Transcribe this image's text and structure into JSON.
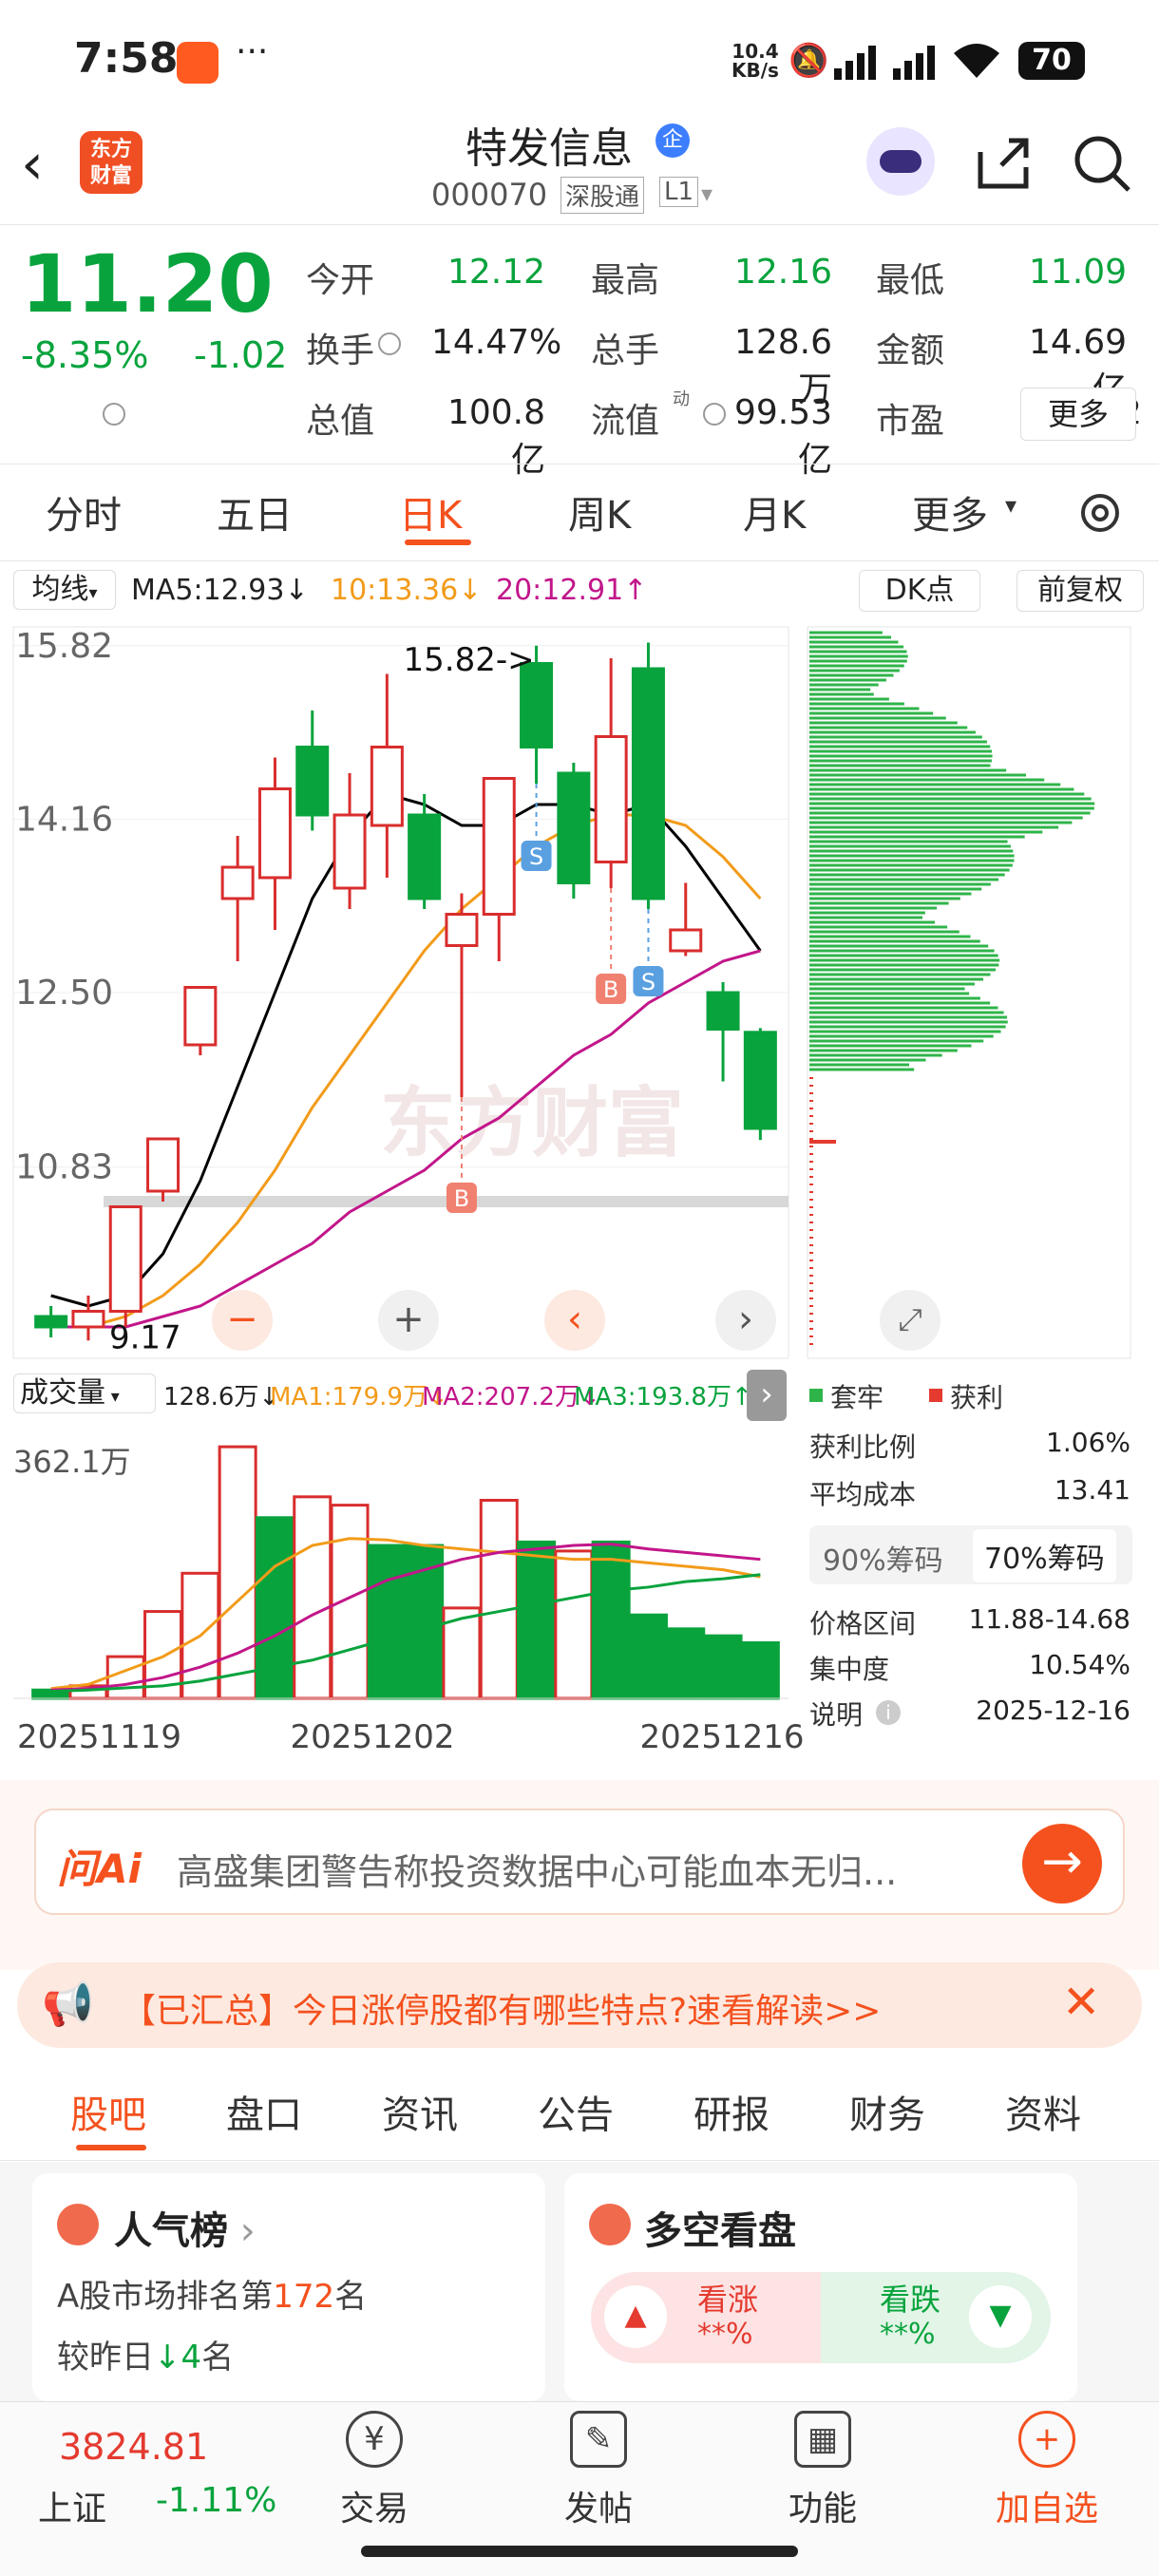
{
  "status": {
    "time": "7:58",
    "net_speed": "10.4",
    "net_unit": "KB/s",
    "battery": "70"
  },
  "header": {
    "logo_line1": "东方",
    "logo_line2": "财富",
    "stock_name": "特发信息",
    "badge": "企",
    "code": "000070",
    "tag1": "深股通",
    "tag2": "L1"
  },
  "quote": {
    "price": "11.20",
    "change_pct": "-8.35%",
    "change": "-1.02",
    "rows": [
      [
        {
          "label": "今开",
          "value": "12.12"
        },
        {
          "label": "最高",
          "value": "12.16"
        },
        {
          "label": "最低",
          "value": "11.09"
        }
      ],
      [
        {
          "label": "换手",
          "value": "14.47%"
        },
        {
          "label": "总手",
          "value": "128.6万"
        },
        {
          "label": "金额",
          "value": "14.69亿"
        }
      ],
      [
        {
          "label": "总值",
          "value": "100.8亿"
        },
        {
          "label": "流值",
          "value": "99.53亿"
        },
        {
          "label": "市盈",
          "value": "945.82"
        }
      ]
    ],
    "pe_sup": "动",
    "more": "更多"
  },
  "period_tabs": [
    "分时",
    "五日",
    "日K",
    "周K",
    "月K",
    "更多"
  ],
  "active_tab": "日K",
  "ma_bar": {
    "selector": "均线",
    "ma5": "MA5:12.93",
    "ma10": "10:13.36",
    "ma20": "20:12.91",
    "dk": "DK点",
    "fq": "前复权"
  },
  "chart_data": [
    {
      "type": "candlestick",
      "title": "",
      "watermark": "东方财富",
      "y_ticks": [
        "15.82",
        "14.16",
        "12.50",
        "10.83"
      ],
      "ylim": [
        9.0,
        16.0
      ],
      "high_label": "15.82->",
      "low_label": "9.17",
      "candles": [
        {
          "o": 9.4,
          "c": 9.3,
          "h": 9.5,
          "l": 9.2
        },
        {
          "o": 9.3,
          "c": 9.45,
          "h": 9.6,
          "l": 9.17
        },
        {
          "o": 9.45,
          "c": 10.45,
          "h": 10.45,
          "l": 9.3
        },
        {
          "o": 10.6,
          "c": 11.1,
          "h": 11.1,
          "l": 10.5
        },
        {
          "o": 12.0,
          "c": 12.55,
          "h": 12.55,
          "l": 11.9
        },
        {
          "o": 13.4,
          "c": 13.7,
          "h": 14.0,
          "l": 12.8
        },
        {
          "o": 13.6,
          "c": 14.45,
          "h": 14.75,
          "l": 13.1
        },
        {
          "o": 14.85,
          "c": 14.2,
          "h": 15.2,
          "l": 14.05
        },
        {
          "o": 13.5,
          "c": 14.2,
          "h": 14.6,
          "l": 13.3
        },
        {
          "o": 14.1,
          "c": 14.85,
          "h": 15.55,
          "l": 13.6
        },
        {
          "o": 14.2,
          "c": 13.4,
          "h": 14.4,
          "l": 13.3
        },
        {
          "o": 12.95,
          "c": 13.25,
          "h": 13.45,
          "l": 11.5
        },
        {
          "o": 13.25,
          "c": 14.55,
          "h": 14.55,
          "l": 12.8
        },
        {
          "o": 15.65,
          "c": 14.85,
          "h": 15.82,
          "l": 14.5
        },
        {
          "o": 14.6,
          "c": 13.55,
          "h": 14.7,
          "l": 13.4
        },
        {
          "o": 13.75,
          "c": 14.95,
          "h": 15.7,
          "l": 13.5
        },
        {
          "o": 15.6,
          "c": 13.4,
          "h": 15.85,
          "l": 13.3
        },
        {
          "o": 12.9,
          "c": 13.1,
          "h": 13.55,
          "l": 12.85
        },
        {
          "o": 12.5,
          "c": 12.15,
          "h": 12.6,
          "l": 11.65
        },
        {
          "o": 12.12,
          "c": 11.2,
          "h": 12.16,
          "l": 11.09
        }
      ],
      "series": [
        {
          "name": "MA5",
          "color": "#000000",
          "values": [
            9.6,
            9.5,
            9.6,
            10.0,
            10.7,
            11.6,
            12.5,
            13.4,
            14.0,
            14.4,
            14.3,
            14.1,
            14.1,
            14.3,
            14.3,
            14.2,
            14.3,
            13.9,
            13.4,
            12.9
          ]
        },
        {
          "name": "MA10",
          "color": "#f29b1a",
          "values": [
            9.3,
            9.3,
            9.4,
            9.6,
            9.9,
            10.3,
            10.8,
            11.4,
            11.9,
            12.4,
            12.9,
            13.3,
            13.6,
            13.9,
            14.1,
            14.2,
            14.2,
            14.1,
            13.8,
            13.4
          ]
        },
        {
          "name": "MA20",
          "color": "#c2168a",
          "values": [
            9.3,
            9.3,
            9.3,
            9.4,
            9.5,
            9.7,
            9.9,
            10.1,
            10.4,
            10.6,
            10.8,
            11.1,
            11.3,
            11.6,
            11.9,
            12.1,
            12.4,
            12.6,
            12.8,
            12.9
          ]
        }
      ],
      "signals": [
        {
          "type": "B",
          "index": 11
        },
        {
          "type": "S",
          "index": 13
        },
        {
          "type": "B",
          "index": 15
        },
        {
          "type": "S",
          "index": 16
        }
      ],
      "chips": {
        "legend": [
          "套牢",
          "获利"
        ],
        "rows": [
          {
            "label": "获利比例",
            "value": "1.06%"
          },
          {
            "label": "平均成本",
            "value": "13.41"
          }
        ],
        "tabs": [
          "90%筹码",
          "70%筹码"
        ],
        "rows2": [
          {
            "label": "价格区间",
            "value": "11.88-14.68"
          },
          {
            "label": "集中度",
            "value": "10.54%"
          },
          {
            "label": "说明",
            "value": "2025-12-16"
          }
        ]
      }
    },
    {
      "type": "bar",
      "title": "成交量",
      "header": {
        "vol": "128.6万",
        "ma1": "MA1:179.9万",
        "ma2": "MA2:207.2万",
        "ma3": "MA3:193.8万"
      },
      "y_tick": "362.1万",
      "ylim": [
        0,
        380
      ],
      "x_ticks": [
        "20251119",
        "20251202",
        "20251216"
      ],
      "values": [
        12,
        18,
        60,
        125,
        180,
        362,
        260,
        290,
        278,
        220,
        220,
        130,
        285,
        225,
        212,
        225,
        120,
        100,
        90,
        80
      ],
      "up": [
        false,
        true,
        true,
        true,
        true,
        true,
        false,
        true,
        true,
        false,
        false,
        true,
        true,
        false,
        true,
        false,
        false,
        false,
        false,
        false
      ]
    }
  ],
  "ai": {
    "label": "问Ai",
    "text": "高盛集团警告称投资数据中心可能血本无归..."
  },
  "banner": {
    "text": "【已汇总】今日涨停股都有哪些特点?速看解读>>"
  },
  "sub_tabs": [
    "股吧",
    "盘口",
    "资讯",
    "公告",
    "研报",
    "财务",
    "资料"
  ],
  "cards": {
    "pop_title": "人气榜",
    "rank_prefix": "A股市场排名第",
    "rank": "172",
    "rank_suffix": "名",
    "change_prefix": "较昨日",
    "change": "4",
    "change_suffix": "名",
    "ls_title": "多空看盘",
    "up_label": "看涨",
    "down_label": "看跌",
    "up_val": "**%",
    "down_val": "**%"
  },
  "bottom": {
    "index_val": "3824.81",
    "index_name": "上证",
    "index_pct": "-1.11%",
    "nav": [
      "交易",
      "发帖",
      "功能",
      "加自选"
    ]
  }
}
